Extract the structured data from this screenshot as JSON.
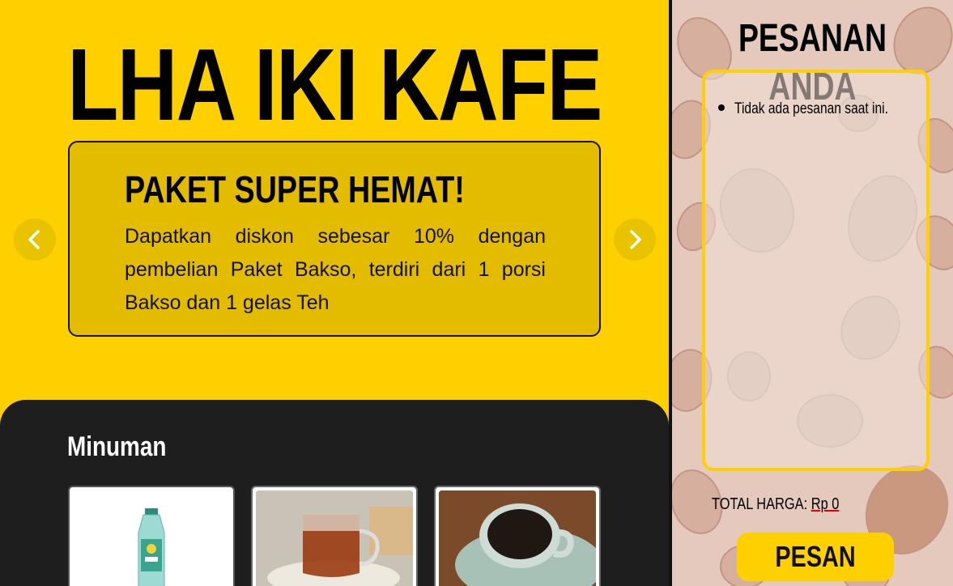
{
  "header": {
    "title": "LHA IKI KAFE"
  },
  "promo": {
    "title": "PAKET SUPER HEMAT!",
    "description": "Dapatkan diskon sebesar 10% dengan pembelian Paket Bakso, terdiri dari 1 porsi Bakso dan 1 gelas Teh"
  },
  "carousel": {
    "prev_icon": "chevron-left-icon",
    "next_icon": "chevron-right-icon"
  },
  "menu": {
    "category": "Minuman",
    "items": [
      {
        "image": "bottled-water-image"
      },
      {
        "image": "tea-glass-image"
      },
      {
        "image": "coffee-cup-image"
      }
    ]
  },
  "order": {
    "title": "PESANAN ANDA",
    "empty_message": "Tidak ada pesanan saat ini.",
    "total_label": "TOTAL HARGA:",
    "total_value": "Rp 0",
    "submit_label": "PESAN"
  },
  "colors": {
    "accent": "#fed000",
    "dark": "#1e1e1e",
    "sidebar": "#e5c9bd"
  }
}
